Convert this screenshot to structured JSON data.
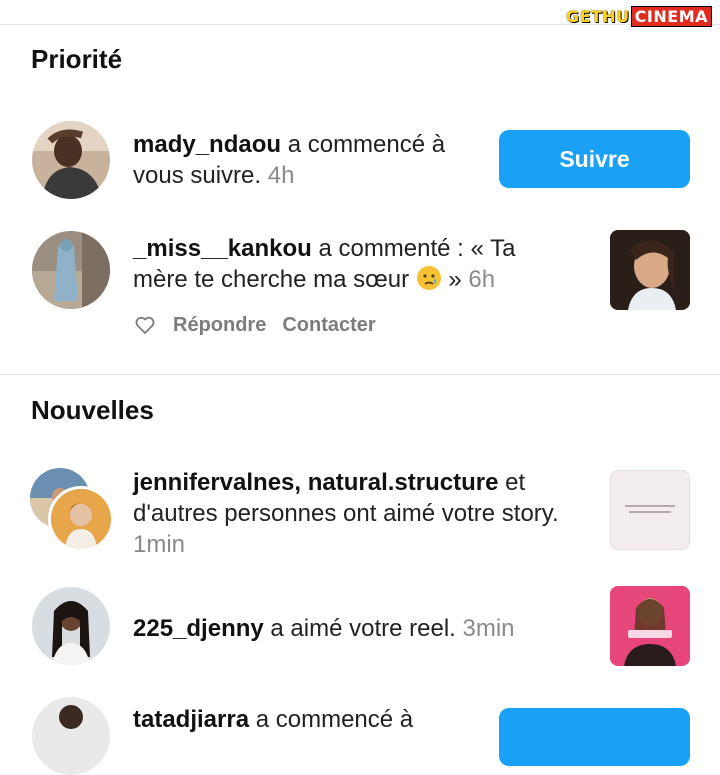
{
  "watermark": {
    "part1": "GETHU",
    "part2": "CINEMA"
  },
  "sections": {
    "priority_title": "Priorité",
    "new_title": "Nouvelles"
  },
  "notifications": [
    {
      "username": "mady_ndaou",
      "text": " a commencé à vous suivre.",
      "time": " 4h",
      "button": "Suivre"
    },
    {
      "username": "_miss__kankou",
      "text": " a commenté : « Ta mère te cherche ma sœur ",
      "text_end": " »",
      "time": " 6h",
      "actions": {
        "reply": "Répondre",
        "contact": "Contacter"
      }
    },
    {
      "username": "jennifervalnes, natural.structure",
      "text": " et d'autres personnes ont aimé votre story.",
      "time": " 1min"
    },
    {
      "username": "225_djenny",
      "text": " a aimé votre reel.",
      "time": " 3min"
    },
    {
      "username": "tatadjiarra",
      "text": " a commencé à"
    }
  ],
  "icons": {
    "heart": "heart-outline-icon",
    "emoji": "crying-face-emoji"
  },
  "colors": {
    "accent": "#1aa1f6",
    "muted": "#8a8a8a"
  }
}
